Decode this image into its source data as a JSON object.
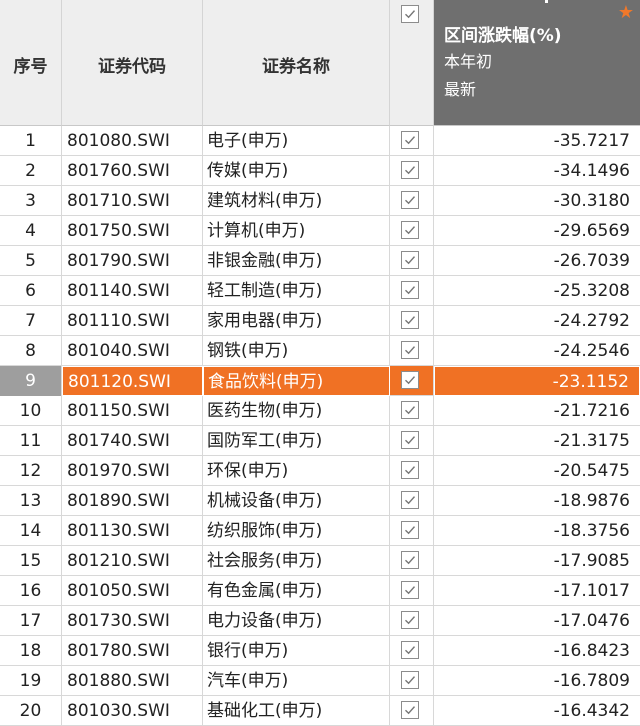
{
  "header": {
    "seq_label": "序号",
    "code_label": "证券代码",
    "name_label": "证券名称",
    "change_title": "区间涨跌幅(%)",
    "change_period": "本年初",
    "change_end": "最新",
    "all_checked": true,
    "star_icon": "star-icon"
  },
  "colors": {
    "highlight_row": "#f07124",
    "header_change_bg": "#6f6f6f",
    "header_bg": "#eeeeee",
    "star": "#f0782a"
  },
  "selected_index": 9,
  "rows": [
    {
      "seq": "1",
      "code": "801080.SWI",
      "name": "电子(申万)",
      "change": "-35.7217",
      "checked": true
    },
    {
      "seq": "2",
      "code": "801760.SWI",
      "name": "传媒(申万)",
      "change": "-34.1496",
      "checked": true
    },
    {
      "seq": "3",
      "code": "801710.SWI",
      "name": "建筑材料(申万)",
      "change": "-30.3180",
      "checked": true
    },
    {
      "seq": "4",
      "code": "801750.SWI",
      "name": "计算机(申万)",
      "change": "-29.6569",
      "checked": true
    },
    {
      "seq": "5",
      "code": "801790.SWI",
      "name": "非银金融(申万)",
      "change": "-26.7039",
      "checked": true
    },
    {
      "seq": "6",
      "code": "801140.SWI",
      "name": "轻工制造(申万)",
      "change": "-25.3208",
      "checked": true
    },
    {
      "seq": "7",
      "code": "801110.SWI",
      "name": "家用电器(申万)",
      "change": "-24.2792",
      "checked": true
    },
    {
      "seq": "8",
      "code": "801040.SWI",
      "name": "钢铁(申万)",
      "change": "-24.2546",
      "checked": true
    },
    {
      "seq": "9",
      "code": "801120.SWI",
      "name": "食品饮料(申万)",
      "change": "-23.1152",
      "checked": true
    },
    {
      "seq": "10",
      "code": "801150.SWI",
      "name": "医药生物(申万)",
      "change": "-21.7216",
      "checked": true
    },
    {
      "seq": "11",
      "code": "801740.SWI",
      "name": "国防军工(申万)",
      "change": "-21.3175",
      "checked": true
    },
    {
      "seq": "12",
      "code": "801970.SWI",
      "name": "环保(申万)",
      "change": "-20.5475",
      "checked": true
    },
    {
      "seq": "13",
      "code": "801890.SWI",
      "name": "机械设备(申万)",
      "change": "-18.9876",
      "checked": true
    },
    {
      "seq": "14",
      "code": "801130.SWI",
      "name": "纺织服饰(申万)",
      "change": "-18.3756",
      "checked": true
    },
    {
      "seq": "15",
      "code": "801210.SWI",
      "name": "社会服务(申万)",
      "change": "-17.9085",
      "checked": true
    },
    {
      "seq": "16",
      "code": "801050.SWI",
      "name": "有色金属(申万)",
      "change": "-17.1017",
      "checked": true
    },
    {
      "seq": "17",
      "code": "801730.SWI",
      "name": "电力设备(申万)",
      "change": "-17.0476",
      "checked": true
    },
    {
      "seq": "18",
      "code": "801780.SWI",
      "name": "银行(申万)",
      "change": "-16.8423",
      "checked": true
    },
    {
      "seq": "19",
      "code": "801880.SWI",
      "name": "汽车(申万)",
      "change": "-16.7809",
      "checked": true
    },
    {
      "seq": "20",
      "code": "801030.SWI",
      "name": "基础化工(申万)",
      "change": "-16.4342",
      "checked": true
    }
  ]
}
